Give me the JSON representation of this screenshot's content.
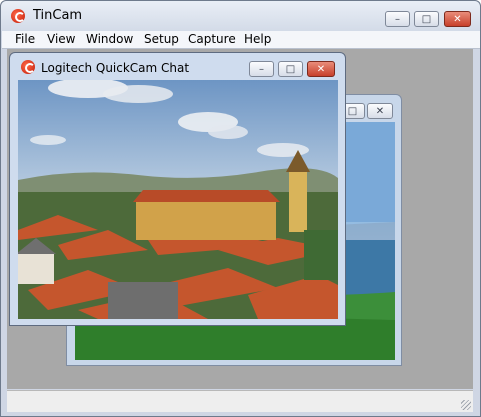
{
  "main_window": {
    "title": "TinCam",
    "minimize_glyph": "–",
    "maximize_glyph": "□",
    "close_glyph": "✕"
  },
  "menu": [
    {
      "label": "File"
    },
    {
      "label": "View"
    },
    {
      "label": "Window"
    },
    {
      "label": "Setup"
    },
    {
      "label": "Capture"
    },
    {
      "label": "Help"
    }
  ],
  "front_window": {
    "title": "Logitech QuickCam Chat",
    "minimize_glyph": "–",
    "maximize_glyph": "□",
    "close_glyph": "✕"
  },
  "back_window": {
    "minimize_glyph": "–",
    "maximize_glyph": "□",
    "close_glyph": "✕"
  },
  "icons": {
    "app": "tincam-app-icon",
    "webcam": "webcam-app-icon"
  },
  "colors": {
    "client_area": "#a8a8a8",
    "close_button": "#c7402b",
    "sky": "#8fb1d6",
    "roofs": "#c5562d"
  }
}
